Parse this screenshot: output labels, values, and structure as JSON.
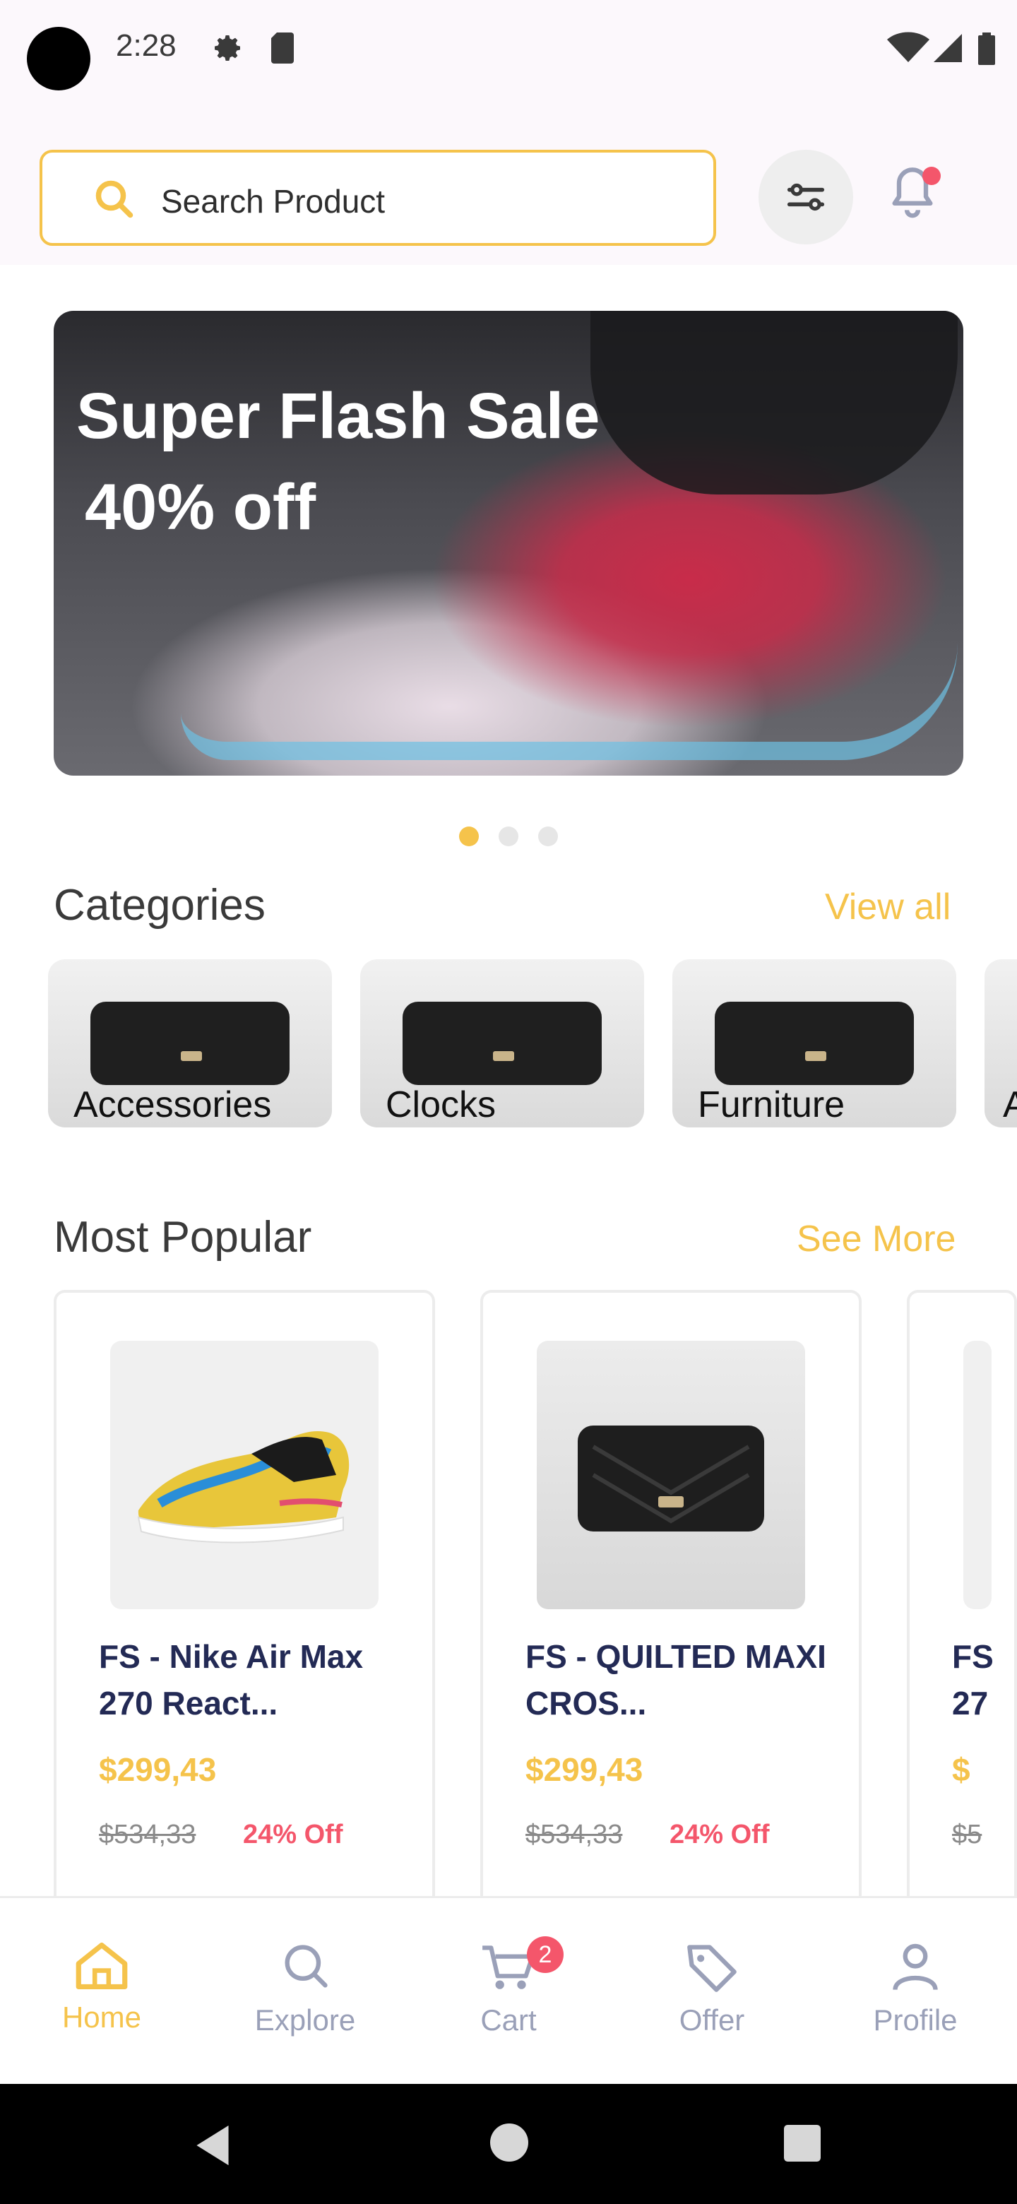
{
  "status_bar": {
    "time": "2:28"
  },
  "search": {
    "placeholder": "Search Product"
  },
  "banner": {
    "title": "Super Flash Sale",
    "subtitle": "40% off"
  },
  "carousel": {
    "total": 3,
    "active": 1
  },
  "categories": {
    "title": "Categories",
    "link": "View all",
    "items": [
      {
        "label": "Accessories"
      },
      {
        "label": "Clocks"
      },
      {
        "label": "Furniture"
      },
      {
        "label": "A"
      }
    ]
  },
  "popular": {
    "title": "Most Popular",
    "link": "See More",
    "products": [
      {
        "name": "FS - Nike Air Max 270 React...",
        "price": "$299,43",
        "old_price": "$534,33",
        "discount": "24% Off"
      },
      {
        "name": "FS - QUILTED MAXI CROS...",
        "price": "$299,43",
        "old_price": "$534,33",
        "discount": "24% Off"
      },
      {
        "name": "FS 27",
        "price": "$",
        "old_price": "$5",
        "discount": ""
      }
    ]
  },
  "nav": {
    "items": [
      {
        "label": "Home",
        "icon": "home-icon",
        "active": true
      },
      {
        "label": "Explore",
        "icon": "search-icon"
      },
      {
        "label": "Cart",
        "icon": "cart-icon",
        "badge": "2"
      },
      {
        "label": "Offer",
        "icon": "tag-icon"
      },
      {
        "label": "Profile",
        "icon": "person-icon"
      }
    ]
  },
  "colors": {
    "accent": "#f5c34b",
    "product_name": "#232a55",
    "discount": "#f4566b",
    "nav_inactive": "#9aa0b8"
  }
}
